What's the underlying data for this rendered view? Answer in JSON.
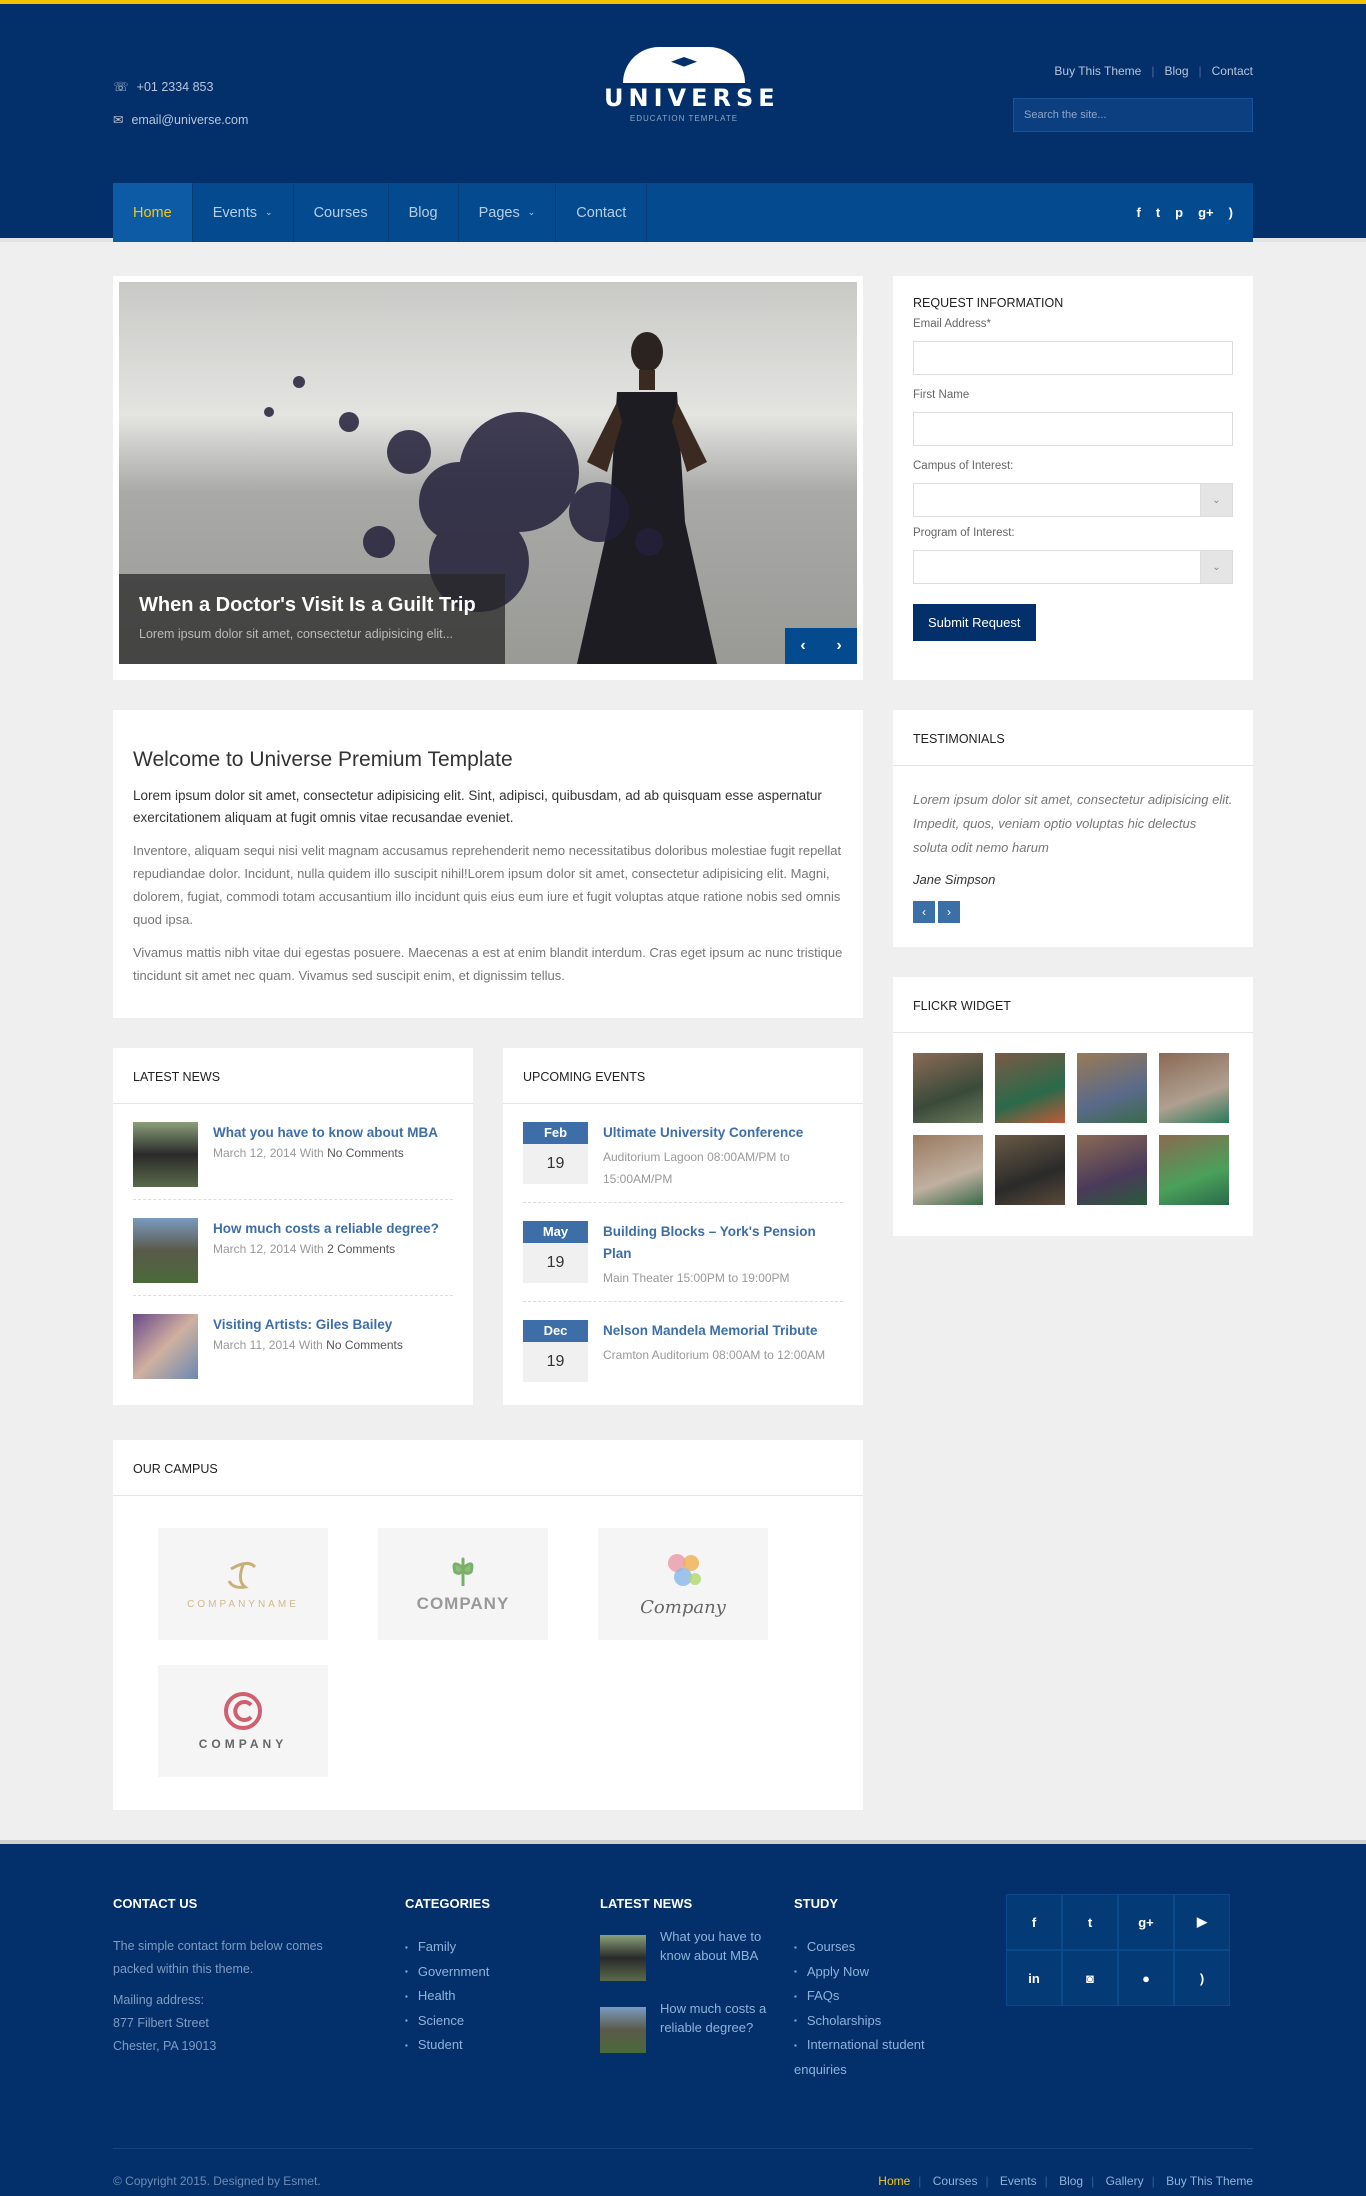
{
  "header": {
    "phone": "+01 2334 853",
    "email": "email@universe.com",
    "logo_name": "UNIVERSE",
    "logo_tag": "EDUCATION TEMPLATE",
    "links": [
      "Buy This Theme",
      "Blog",
      "Contact"
    ],
    "search_placeholder": "Search the site..."
  },
  "nav": {
    "items": [
      "Home",
      "Events",
      "Courses",
      "Blog",
      "Pages",
      "Contact"
    ],
    "social": [
      "f",
      "t",
      "p",
      "g+",
      "rss"
    ]
  },
  "slider": {
    "title": "When a Doctor's Visit Is a Guilt Trip",
    "text": "Lorem ipsum dolor sit amet, consectetur adipisicing elit..."
  },
  "request": {
    "title": "REQUEST INFORMATION",
    "email_label": "Email Address*",
    "first_name_label": "First Name",
    "campus_label": "Campus of Interest:",
    "program_label": "Program of Interest:",
    "submit": "Submit Request"
  },
  "welcome": {
    "title": "Welcome to Universe Premium Template",
    "lead": "Lorem ipsum dolor sit amet, consectetur adipisicing elit. Sint, adipisci, quibusdam, ad ab quisquam esse aspernatur exercitationem aliquam at fugit omnis vitae recusandae eveniet.",
    "p1": "Inventore, aliquam sequi nisi velit magnam accusamus reprehenderit nemo necessitatibus doloribus molestiae fugit repellat repudiandae dolor. Incidunt, nulla quidem illo suscipit nihil!Lorem ipsum dolor sit amet, consectetur adipisicing elit. Magni, dolorem, fugiat, commodi totam accusantium illo incidunt quis eius eum iure et fugit voluptas atque ratione nobis sed omnis quod ipsa.",
    "p2": "Vivamus mattis nibh vitae dui egestas posuere. Maecenas a est at enim blandit interdum. Cras eget ipsum ac nunc tristique tincidunt sit amet nec quam. Vivamus sed suscipit enim, et dignissim tellus."
  },
  "testimonials": {
    "title": "TESTIMONIALS",
    "quote": "Lorem ipsum dolor sit amet, consectetur adipisicing elit. Impedit, quos, veniam optio voluptas hic delectus soluta odit nemo harum",
    "author": "Jane Simpson"
  },
  "flickr": {
    "title": "FLICKR WIDGET"
  },
  "news": {
    "title": "LATEST NEWS",
    "items": [
      {
        "title": "What you have to know about MBA",
        "meta": "March 12, 2014 With",
        "comments": "No Comments"
      },
      {
        "title": "How much costs a reliable degree?",
        "meta": "March 12, 2014 With",
        "comments": "2 Comments"
      },
      {
        "title": "Visiting Artists: Giles Bailey",
        "meta": "March 11, 2014 With",
        "comments": "No Comments"
      }
    ]
  },
  "events": {
    "title": "UPCOMING EVENTS",
    "items": [
      {
        "month": "Feb",
        "day": "19",
        "title": "Ultimate University Conference",
        "meta": "Auditorium Lagoon 08:00AM/PM to 15:00AM/PM"
      },
      {
        "month": "May",
        "day": "19",
        "title": "Building Blocks – York's Pension Plan",
        "meta": "Main Theater 15:00PM to 19:00PM"
      },
      {
        "month": "Dec",
        "day": "19",
        "title": "Nelson Mandela Memorial Tribute",
        "meta": "Cramton Auditorium 08:00AM to 12:00AM"
      }
    ]
  },
  "campus": {
    "title": "OUR CAMPUS",
    "logos": [
      "COMPANYNAME",
      "COMPANY",
      "Company",
      "COMPANY"
    ]
  },
  "footer": {
    "contact": {
      "title": "CONTACT US",
      "text": "The simple contact form below comes packed within this theme.",
      "addr_label": "Mailing address:",
      "addr1": "877 Filbert Street",
      "addr2": "Chester, PA 19013"
    },
    "categories": {
      "title": "CATEGORIES",
      "items": [
        "Family",
        "Government",
        "Health",
        "Science",
        "Student"
      ]
    },
    "news": {
      "title": "LATEST NEWS",
      "items": [
        "What you have to know about MBA",
        "How much costs a reliable degree?"
      ]
    },
    "study": {
      "title": "STUDY",
      "items": [
        "Courses",
        "Apply Now",
        "FAQs",
        "Scholarships",
        "International student enquiries"
      ]
    },
    "social": [
      "f",
      "t",
      "g+",
      "yt",
      "in",
      "ig",
      "apple",
      "rss"
    ],
    "copyright": "© Copyright 2015. Designed by Esmet.",
    "links": [
      "Home",
      "Courses",
      "Events",
      "Blog",
      "Gallery",
      "Buy This Theme"
    ]
  }
}
